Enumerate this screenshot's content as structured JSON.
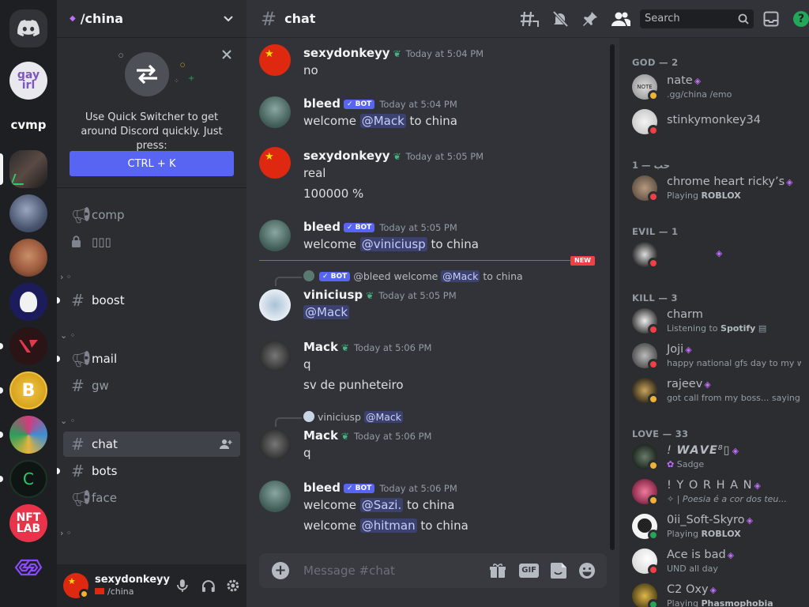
{
  "colors": {
    "accent": "#5865f2",
    "online": "#23a55a",
    "dnd": "#f23f43",
    "idle": "#f0b232",
    "boost": "#c26efc",
    "sprout": "#43b581",
    "new": "#f23f43"
  },
  "rail": {
    "servers": [
      {
        "name": "home-discord",
        "text": ""
      },
      {
        "name": "gay-irl",
        "text": "gay irl"
      },
      {
        "name": "cvmp",
        "text": "cvmp"
      },
      {
        "name": "china",
        "text": ""
      },
      {
        "name": "server-4",
        "text": ""
      },
      {
        "name": "server-5",
        "text": ""
      },
      {
        "name": "server-6",
        "text": ""
      },
      {
        "name": "server-7",
        "text": ""
      },
      {
        "name": "server-8",
        "text": "B"
      },
      {
        "name": "server-9",
        "text": ""
      },
      {
        "name": "server-10",
        "text": "C"
      },
      {
        "name": "nft-lab",
        "text": "NFT LAB"
      },
      {
        "name": "server-12",
        "text": ""
      }
    ]
  },
  "sidebar": {
    "server_name": "/china",
    "quick_switcher": {
      "text": "Use Quick Switcher to get around Discord quickly. Just press:",
      "shortcut": "CTRL + K"
    },
    "channels": [
      {
        "label": "comp",
        "icon": "megaphone-icon"
      },
      {
        "label": "▯▯▯",
        "icon": "lock-icon"
      },
      {
        "label": "boost",
        "icon": "hash-icon",
        "unread": true
      },
      {
        "label": "mail",
        "icon": "megaphone-icon",
        "unread": true
      },
      {
        "label": "gw",
        "icon": "hash-icon"
      },
      {
        "label": "chat",
        "icon": "hash-icon",
        "active": true
      },
      {
        "label": "bots",
        "icon": "hash-icon",
        "unread": true
      },
      {
        "label": "face",
        "icon": "megaphone-icon"
      }
    ],
    "categories": [
      "› ◦",
      "⌄ ◦",
      "⌄ ◦",
      "› ◦"
    ]
  },
  "user": {
    "name": "sexydonkeyy",
    "status": "/china"
  },
  "header": {
    "channel": "chat",
    "search_placeholder": "Search"
  },
  "chat": {
    "messages": [
      {
        "author": "sexydonkeyy",
        "time": "Today at 5:04 PM",
        "lines": [
          "no"
        ]
      },
      {
        "author": "bleed",
        "bot": "BOT",
        "time": "Today at 5:04 PM",
        "lines": [
          {
            "pre": "welcome ",
            "mention": "@Mack",
            "post": " to china"
          }
        ]
      },
      {
        "author": "sexydonkeyy",
        "time": "Today at 5:05 PM",
        "lines": [
          "real",
          "100000 %"
        ]
      },
      {
        "author": "bleed",
        "bot": "BOT",
        "time": "Today at 5:05 PM",
        "lines": [
          {
            "pre": "welcome ",
            "mention": "@viniciusp",
            "post": " to china"
          }
        ]
      },
      {
        "reply": {
          "bot": "BOT",
          "author": "@bleed",
          "pre": "welcome ",
          "mention": "@Mack",
          "post": " to china"
        },
        "author": "viniciusp",
        "time": "Today at 5:05 PM",
        "lines": [
          {
            "pre": "",
            "mention": "@Mack",
            "post": ""
          }
        ]
      },
      {
        "author": "Mack",
        "time": "Today at 5:06 PM",
        "lines": [
          "q",
          "sv de punheteiro"
        ]
      },
      {
        "reply": {
          "author": "viniciusp",
          "mention": "@Mack"
        },
        "author": "Mack",
        "time": "Today at 5:06 PM",
        "lines": [
          "q"
        ]
      },
      {
        "author": "bleed",
        "bot": "BOT",
        "time": "Today at 5:06 PM",
        "lines": [
          {
            "pre": "welcome ",
            "mention": "@Sazi.",
            "post": " to china"
          },
          {
            "pre": "welcome ",
            "mention": "@hitman",
            "post": " to china"
          }
        ]
      }
    ],
    "new_label": "NEW",
    "composer_placeholder": "Message #chat",
    "gif_label": "GIF"
  },
  "members": {
    "groups": [
      {
        "title": "GOD — 2",
        "members": [
          {
            "name": "nate",
            "sub": ".gg/china /emo",
            "status": "idle",
            "boost": true
          },
          {
            "name": "stinkymonkey34",
            "sub": "",
            "status": "dnd"
          }
        ]
      },
      {
        "title": "1 — حب",
        "members": [
          {
            "name": "chrome heart ricky’s",
            "sub": "Playing ",
            "sub_bold": "ROBLOX",
            "status": "dnd",
            "boost": true
          }
        ]
      },
      {
        "title": "EVIL — 1",
        "members": [
          {
            "name": "",
            "sub": "",
            "status": "dnd",
            "boost": true
          }
        ]
      },
      {
        "title": "KILL — 3",
        "members": [
          {
            "name": "charm",
            "sub": "Listening to ",
            "sub_bold": "Spotify",
            "status": "dnd"
          },
          {
            "name": "Joji",
            "sub": "happy national gfs day to my w...",
            "status": "dnd",
            "boost": true
          },
          {
            "name": "rajeev",
            "sub": "got call from my boss... saying ...",
            "status": "idle",
            "boost": true
          }
        ]
      },
      {
        "title": "LOVE — 33",
        "members": [
          {
            "name": "! 𝙒𝘼𝙑𝙀⁸▯",
            "sub": "Sadge",
            "status": "idle",
            "boost": true
          },
          {
            "name": "! Y O R H A N",
            "sub": "| Poesia é a cor dos teu...",
            "status": "idle",
            "boost": true
          },
          {
            "name": "0ii_Soft-Skyro",
            "sub": "Playing ",
            "sub_bold": "ROBLOX",
            "status": "online",
            "boost": true
          },
          {
            "name": "Ace is bad",
            "sub": "UND all day",
            "status": "dnd",
            "boost": true
          },
          {
            "name": "C2 Oxy",
            "sub": "Playing ",
            "sub_bold": "Phasmophobia",
            "status": "online",
            "boost": true
          }
        ]
      }
    ]
  }
}
